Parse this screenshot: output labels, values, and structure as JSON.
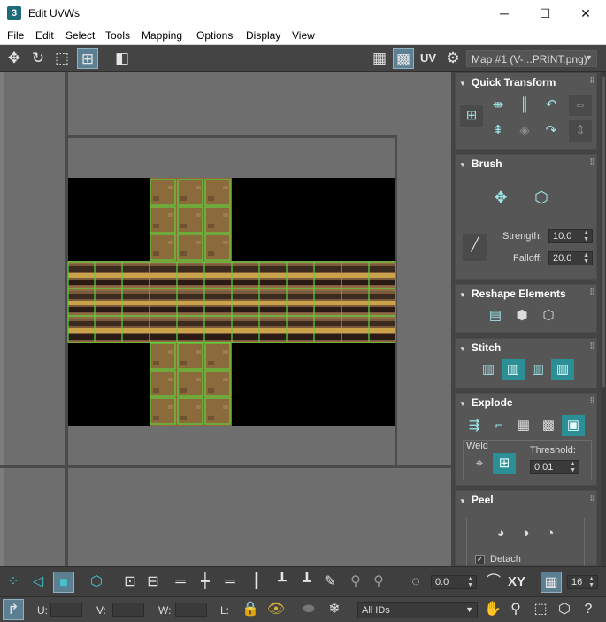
{
  "window": {
    "app_icon_text": "3",
    "title": "Edit UVWs"
  },
  "window_controls": {
    "minimize": "─",
    "maximize": "☐",
    "close": "✕"
  },
  "menu": [
    "File",
    "Edit",
    "Select",
    "Tools",
    "Mapping",
    "Options",
    "Display",
    "View"
  ],
  "top_toolbar": {
    "icons": [
      "move-icon",
      "rotate-icon",
      "scale-icon",
      "freeform-icon",
      "mirror-icon",
      "checker-off-icon",
      "checker-on-icon",
      "uv-icon",
      "map-settings-icon"
    ],
    "uv_label": "UV",
    "map_dropdown": "Map #1 (V-...PRINT.png)"
  },
  "side_panel": {
    "quick_transform": {
      "title": "Quick Transform"
    },
    "brush": {
      "title": "Brush",
      "strength_label": "Strength:",
      "strength_value": "10.0",
      "falloff_label": "Falloff:",
      "falloff_value": "20.0"
    },
    "reshape": {
      "title": "Reshape Elements"
    },
    "stitch": {
      "title": "Stitch"
    },
    "explode": {
      "title": "Explode",
      "weld_label": "Weld",
      "threshold_label": "Threshold:",
      "threshold_value": "0.01"
    },
    "peel": {
      "title": "Peel",
      "detach_label": "Detach",
      "detach_checked": true
    }
  },
  "bottom_toolbar": {
    "angle_value": "0.0",
    "xy_label": "XY",
    "grid_value": "16"
  },
  "status_bar": {
    "u_label": "U:",
    "v_label": "V:",
    "w_label": "W:",
    "l_label": "L:",
    "ids_select": "All IDs"
  },
  "colors": {
    "uv_edge": "#5fd33b",
    "accent": "#43c4cc",
    "texture_background": "#000000"
  }
}
